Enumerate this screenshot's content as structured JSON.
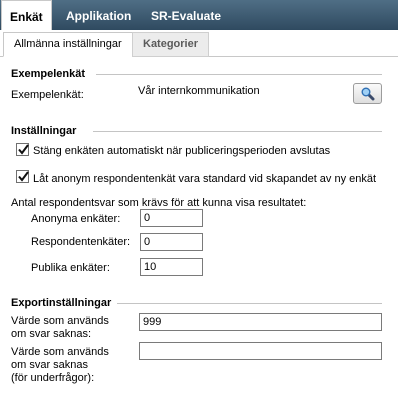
{
  "top_tabs": [
    "Enkät",
    "Applikation",
    "SR-Evaluate"
  ],
  "sub_tabs": [
    "Allmänna inställningar",
    "Kategorier"
  ],
  "example": {
    "section_title": "Exempelenkät",
    "label": "Exempelenkät:",
    "value": "Vår internkommunikation"
  },
  "settings": {
    "section_title": "Inställningar",
    "checkbox1_label": "Stäng enkäten automatiskt när publiceringsperioden avslutas",
    "checkbox1_checked": true,
    "checkbox2_label": "Låt anonym respondentenkät vara standard vid skapandet av ny enkät",
    "checkbox2_checked": true,
    "min_responses_label": "Antal respondentsvar som krävs för att kunna visa resultatet:",
    "anonymous_label": "Anonyma enkäter:",
    "anonymous_value": "0",
    "respondent_label": "Respondentenkäter:",
    "respondent_value": "0",
    "public_label": "Publika enkäter:",
    "public_value": "10"
  },
  "export": {
    "section_title": "Exportinställningar",
    "missing_label_1": "Värde som används",
    "missing_label_2": "om svar saknas:",
    "missing_value": "999",
    "sub_missing_label_1": "Värde som används",
    "sub_missing_label_2": "om svar saknas",
    "sub_missing_label_3": "(för underfrågor):",
    "sub_missing_value": ""
  },
  "icons": {
    "search": "magnifier-icon",
    "check": "checkmark-icon"
  }
}
